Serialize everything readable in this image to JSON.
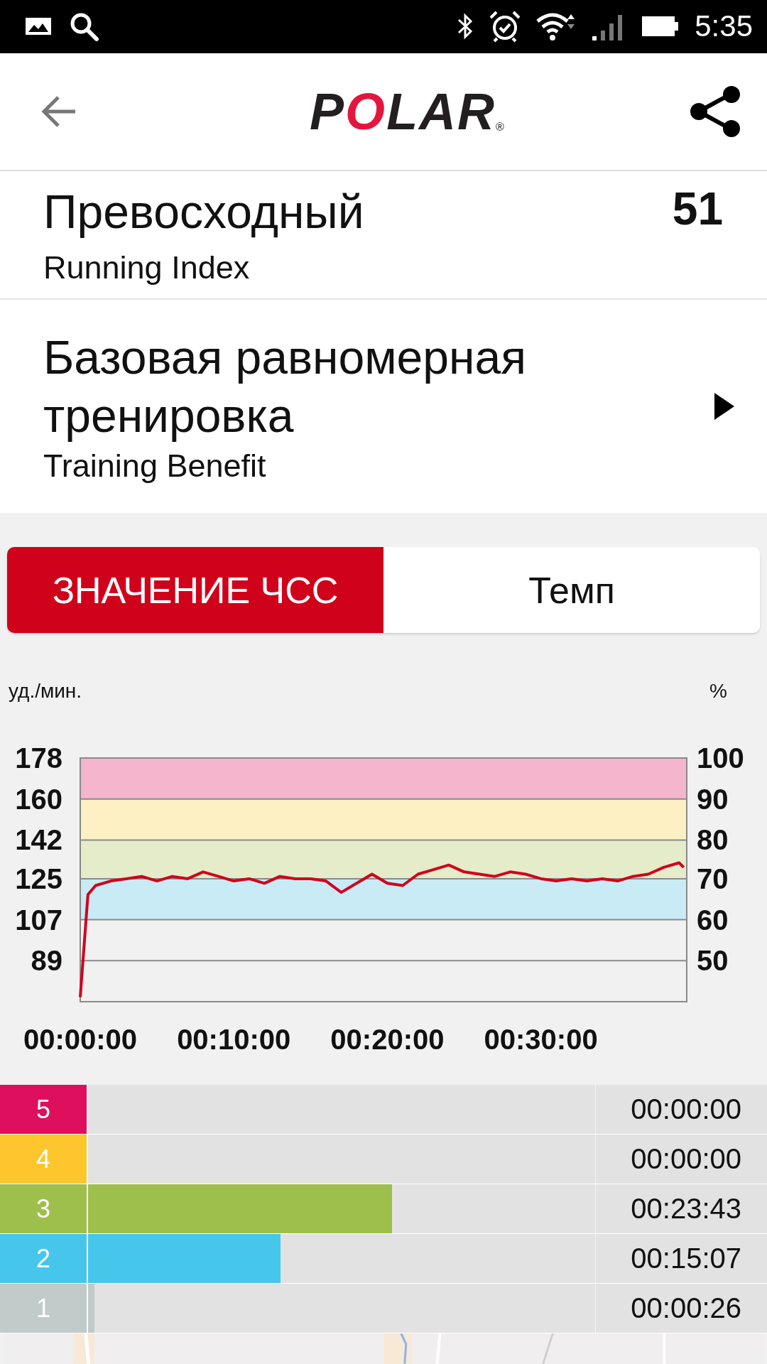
{
  "status_bar": {
    "time": "5:35"
  },
  "toolbar": {
    "logo": "POLAR",
    "logo_mark": "®"
  },
  "running_index": {
    "title": "Превосходный",
    "subtitle": "Running Index",
    "value": "51"
  },
  "training_benefit": {
    "title": "Базовая равномерная тренировка",
    "subtitle": "Training Benefit"
  },
  "tabs": [
    {
      "label": "ЗНАЧЕНИЕ ЧСС",
      "selected": true
    },
    {
      "label": "Темп",
      "selected": false
    }
  ],
  "chart": {
    "left_unit": "уд./мин.",
    "right_unit": "%",
    "right_ticks": [
      "100",
      "90",
      "80",
      "70",
      "60",
      "50"
    ],
    "chart_data": {
      "type": "line",
      "x": [
        0,
        0.5,
        1,
        2,
        3,
        4,
        5,
        6,
        7,
        8,
        9,
        10,
        11,
        12,
        13,
        14,
        15,
        16,
        17,
        18,
        19,
        20,
        21,
        22,
        23,
        24,
        25,
        26,
        27,
        28,
        29,
        30,
        31,
        32,
        33,
        34,
        35,
        36,
        37,
        38,
        39,
        39.3
      ],
      "series": [
        {
          "color": "#d0021b",
          "values": [
            73,
            118,
            122,
            124,
            125,
            126,
            124,
            126,
            125,
            128,
            126,
            124,
            125,
            123,
            126,
            125,
            125,
            124,
            119,
            123,
            127,
            123,
            122,
            127,
            129,
            131,
            128,
            127,
            126,
            128,
            127,
            125,
            124,
            125,
            124,
            125,
            124,
            126,
            127,
            130,
            132,
            130
          ]
        }
      ],
      "xlim": [
        0,
        39.5
      ],
      "ylim": [
        71,
        178
      ],
      "xticks": [
        {
          "value": 0,
          "label": "00:00:00"
        },
        {
          "value": 10,
          "label": "00:10:00"
        },
        {
          "value": 20,
          "label": "00:20:00"
        },
        {
          "value": 30,
          "label": "00:30:00"
        }
      ],
      "yticks": [
        178,
        160,
        142,
        125,
        107,
        89
      ],
      "grid": true,
      "bands": [
        {
          "axis": "y",
          "from": 160,
          "to": 178,
          "color": "#f5b5cc"
        },
        {
          "axis": "y",
          "from": 142,
          "to": 160,
          "color": "#fdf0c3"
        },
        {
          "axis": "y",
          "from": 125,
          "to": 142,
          "color": "#e4ecca"
        },
        {
          "axis": "y",
          "from": 107,
          "to": 125,
          "color": "#c9ebf6"
        }
      ]
    }
  },
  "zones": [
    {
      "label": "5",
      "color": "#de0f5c",
      "time": "00:00:00"
    },
    {
      "label": "4",
      "color": "#fec62d",
      "time": "00:00:00"
    },
    {
      "label": "3",
      "color": "#9fbf4d",
      "level": 0.6,
      "time": "00:23:43"
    },
    {
      "label": "2",
      "color": "#47c6ec",
      "level": 0.38,
      "time": "00:15:07"
    },
    {
      "label": "1",
      "color": "#c0cbca",
      "level": 0.012,
      "time": "00:00:26"
    }
  ]
}
